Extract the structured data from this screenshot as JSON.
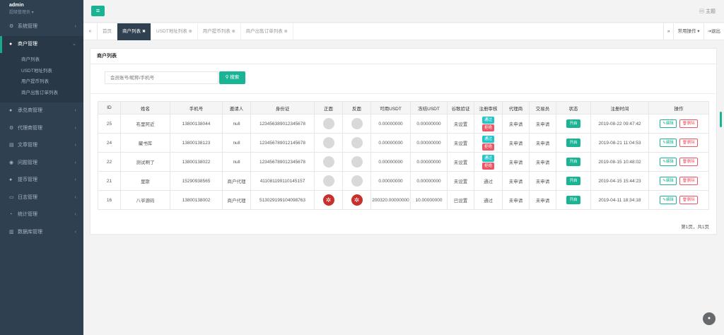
{
  "sidebar": {
    "user_name": "admin",
    "user_role": "超级管理员 ▾",
    "items": [
      {
        "label": "系统管理",
        "icon": "gear-icon"
      },
      {
        "label": "商户管理",
        "icon": "user-icon"
      },
      {
        "label": "承兑商管理",
        "icon": "user-icon"
      },
      {
        "label": "代理商管理",
        "icon": "gear-icon"
      },
      {
        "label": "文章管理",
        "icon": "document-icon"
      },
      {
        "label": "问题管理",
        "icon": "chat-icon"
      },
      {
        "label": "提币管理",
        "icon": "user-icon"
      },
      {
        "label": "日志管理",
        "icon": "monitor-icon"
      },
      {
        "label": "统计管理",
        "icon": "chart-icon"
      },
      {
        "label": "数据库管理",
        "icon": "database-icon"
      }
    ],
    "sub_items": [
      "商户列表",
      "USDT地址列表",
      "用户提币列表",
      "商户出售订单列表"
    ]
  },
  "header": {
    "theme_label": "主题"
  },
  "tabs": {
    "home": "首页",
    "items": [
      "商户列表",
      "USDT地址列表",
      "用户提币列表",
      "商户出售订单列表"
    ],
    "common_ops": "常用操作 ▾",
    "logout": "退出"
  },
  "panel": {
    "title": "商户列表",
    "search_placeholder": "会员账号/昵称/手机号",
    "search_button": "搜索",
    "pager": "第1页，共1页"
  },
  "table": {
    "headers": [
      "ID",
      "姓名",
      "手机号",
      "邀请人",
      "身份证",
      "正面",
      "反面",
      "可用USDT",
      "冻结USDT",
      "谷歌验证",
      "注册审核",
      "代理商",
      "交易员",
      "状态",
      "注册时间",
      "操作"
    ],
    "rows": [
      {
        "id": "25",
        "name": "布里阿近",
        "phone": "13800138044",
        "inviter": "null",
        "idcard": "123456389012345678",
        "front": "avatar",
        "back": "avatar",
        "usdt": "0.00000000",
        "frozen": "0.00000000",
        "google": "未设置",
        "review": [
          "通过",
          "拒绝"
        ],
        "agent": "未申请",
        "trader": "未申请",
        "status": "开启",
        "time": "2019-08-22 09:47:42",
        "edit": "编辑",
        "del": "删除"
      },
      {
        "id": "24",
        "name": "藏书库",
        "phone": "13800138123",
        "inviter": "null",
        "idcard": "123456789012145678",
        "front": "avatar",
        "back": "avatar",
        "usdt": "0.00000000",
        "frozen": "0.00000000",
        "google": "未设置",
        "review": [
          "通过",
          "拒绝"
        ],
        "agent": "未申请",
        "trader": "未申请",
        "status": "开启",
        "time": "2019-08-21 11:04:53",
        "edit": "编辑",
        "del": "删除"
      },
      {
        "id": "22",
        "name": "测试啊了",
        "phone": "13800138022",
        "inviter": "null",
        "idcard": "123456789012345678",
        "front": "avatar",
        "back": "avatar",
        "usdt": "0.00000000",
        "frozen": "0.00000000",
        "google": "未设置",
        "review": [
          "通过",
          "拒绝"
        ],
        "agent": "未申请",
        "trader": "未申请",
        "status": "开启",
        "time": "2019-08-15 10:48:02",
        "edit": "编辑",
        "del": "删除"
      },
      {
        "id": "21",
        "name": "里斯",
        "phone": "15290938565",
        "inviter": "商户代理",
        "idcard": "411081199110145157",
        "front": "avatar",
        "back": "avatar",
        "usdt": "0.00000000",
        "frozen": "0.00000000",
        "google": "未设置",
        "review": [
          "通过"
        ],
        "agent": "未申请",
        "trader": "未申请",
        "status": "开启",
        "time": "2019-04-15 15:44:23",
        "edit": "编辑",
        "del": "删除"
      },
      {
        "id": "16",
        "name": "八爷源码",
        "phone": "13800138002",
        "inviter": "商户代理",
        "idcard": "513029199104098763",
        "front": "logo",
        "back": "logo",
        "usdt": "200320.00000000",
        "frozen": "10.00000000",
        "google": "已设置",
        "review": [
          "通过"
        ],
        "agent": "未申请",
        "trader": "未申请",
        "status": "开启",
        "time": "2019-04-11 18:34:18",
        "edit": "编辑",
        "del": "删除"
      }
    ]
  },
  "colors": {
    "sidebar_bg": "#2f4050",
    "accent": "#1ab394",
    "danger": "#ed5565",
    "info": "#23c6c8"
  }
}
